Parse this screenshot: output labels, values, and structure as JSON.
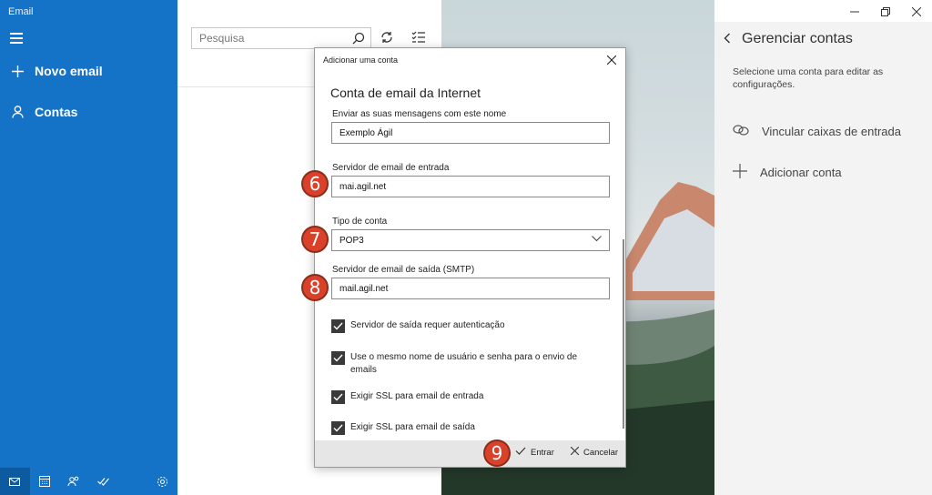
{
  "app": {
    "title": "Email"
  },
  "nav": {
    "new_email": "Novo email",
    "accounts": "Contas",
    "icons": [
      "mail-icon",
      "calendar-icon",
      "people-icon",
      "todo-icon",
      "settings-icon"
    ]
  },
  "list": {
    "search_placeholder": "Pesquisa"
  },
  "right_panel": {
    "title": "Gerenciar contas",
    "description": "Selecione uma conta para editar as configurações.",
    "link_inboxes": "Vincular caixas de entrada",
    "add_account": "Adicionar conta"
  },
  "dialog": {
    "title": "Adicionar uma conta",
    "heading": "Conta de email da Internet",
    "send_name_label": "Enviar as suas mensagens com este nome",
    "send_name_value": "Exemplo Ágil",
    "incoming_label": "Servidor de email de entrada",
    "incoming_value": "mai.agil.net",
    "account_type_label": "Tipo de conta",
    "account_type_value": "POP3",
    "outgoing_label": "Servidor de email de saída (SMTP)",
    "outgoing_value": "mail.agil.net",
    "checkboxes": [
      {
        "label": "Servidor de saída requer autenticação",
        "checked": true
      },
      {
        "label": "Use o mesmo nome de usuário e senha para o envio de emails",
        "checked": true
      },
      {
        "label": "Exigir SSL para email de entrada",
        "checked": true
      },
      {
        "label": "Exigir SSL para email de saída",
        "checked": true
      }
    ],
    "enter_label": "Entrar",
    "cancel_label": "Cancelar"
  },
  "badges": {
    "b6": "6",
    "b7": "7",
    "b8": "8",
    "b9": "9"
  },
  "colors": {
    "nav": "#1473c6",
    "badge": "#d9412b",
    "right_panel": "#f3f3f3"
  }
}
